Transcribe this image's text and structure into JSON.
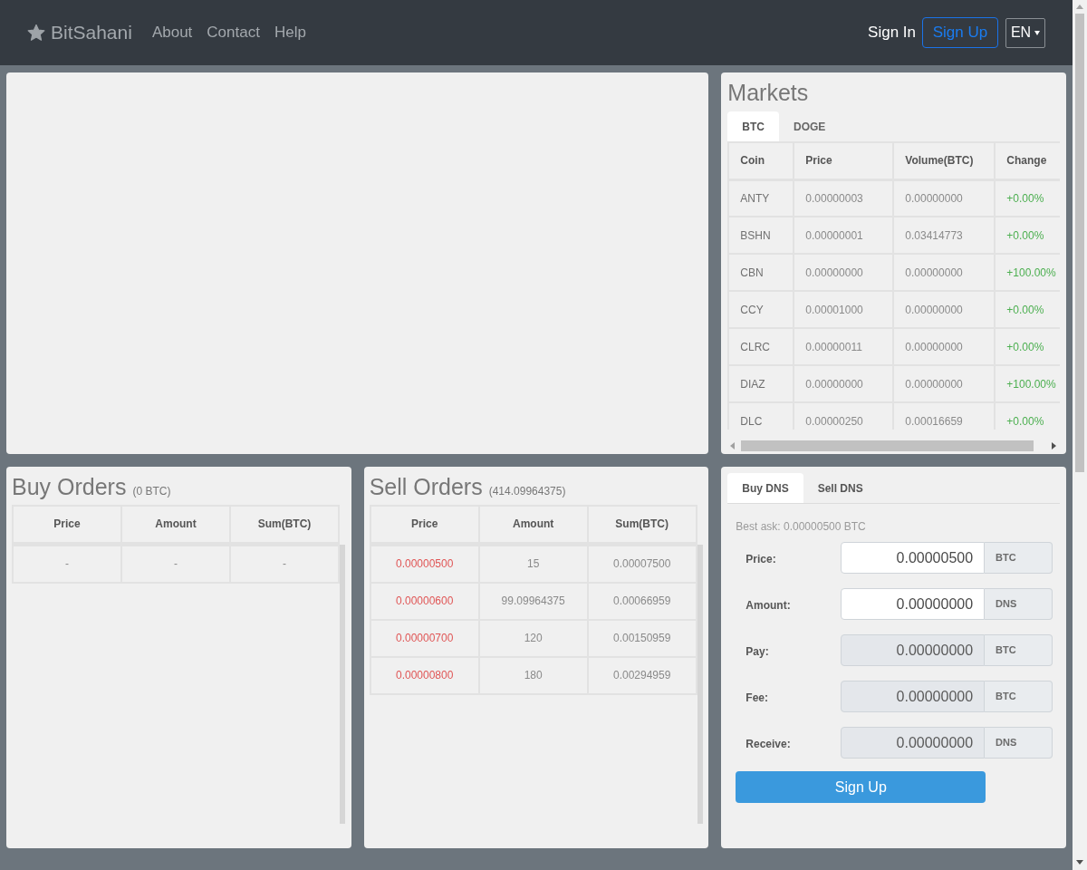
{
  "navbar": {
    "brand": "BitSahani",
    "links": [
      "About",
      "Contact",
      "Help"
    ],
    "sign_in": "Sign In",
    "sign_up": "Sign Up",
    "language": "EN"
  },
  "markets": {
    "title": "Markets",
    "tabs": [
      {
        "label": "BTC",
        "selected": true
      },
      {
        "label": "DOGE",
        "selected": false
      }
    ],
    "columns": [
      "Coin",
      "Price",
      "Volume(BTC)",
      "Change"
    ],
    "rows": [
      [
        "ANTY",
        "0.00000003",
        "0.00000000",
        "+0.00%"
      ],
      [
        "BSHN",
        "0.00000001",
        "0.03414773",
        "+0.00%"
      ],
      [
        "CBN",
        "0.00000000",
        "0.00000000",
        "+100.00%"
      ],
      [
        "CCY",
        "0.00001000",
        "0.00000000",
        "+0.00%"
      ],
      [
        "CLRC",
        "0.00000011",
        "0.00000000",
        "+0.00%"
      ],
      [
        "DIAZ",
        "0.00000000",
        "0.00000000",
        "+100.00%"
      ],
      [
        "DLC",
        "0.00000250",
        "0.00016659",
        "+0.00%"
      ]
    ]
  },
  "buy_orders": {
    "title": "Buy Orders",
    "total": "(0 BTC)",
    "columns": [
      "Price",
      "Amount",
      "Sum(BTC)"
    ],
    "rows": [
      [
        "-",
        "-",
        "-"
      ]
    ]
  },
  "sell_orders": {
    "title": "Sell Orders",
    "total": "(414.09964375)",
    "columns": [
      "Price",
      "Amount",
      "Sum(BTC)"
    ],
    "rows": [
      [
        "0.00000500",
        "15",
        "0.00007500"
      ],
      [
        "0.00000600",
        "99.09964375",
        "0.00066959"
      ],
      [
        "0.00000700",
        "120",
        "0.00150959"
      ],
      [
        "0.00000800",
        "180",
        "0.00294959"
      ]
    ]
  },
  "trade": {
    "tabs": [
      {
        "label": "Buy DNS",
        "selected": true
      },
      {
        "label": "Sell DNS",
        "selected": false
      }
    ],
    "best_ask": "Best ask: 0.00000500 BTC",
    "fields": [
      {
        "label": "Price:",
        "value": "0.00000500",
        "unit": "BTC",
        "disabled": false
      },
      {
        "label": "Amount:",
        "value": "0.00000000",
        "unit": "DNS",
        "disabled": false
      },
      {
        "label": "Pay:",
        "value": "0.00000000",
        "unit": "BTC",
        "disabled": true
      },
      {
        "label": "Fee:",
        "value": "0.00000000",
        "unit": "BTC",
        "disabled": true
      },
      {
        "label": "Receive:",
        "value": "0.00000000",
        "unit": "DNS",
        "disabled": true
      }
    ],
    "submit": "Sign Up"
  }
}
